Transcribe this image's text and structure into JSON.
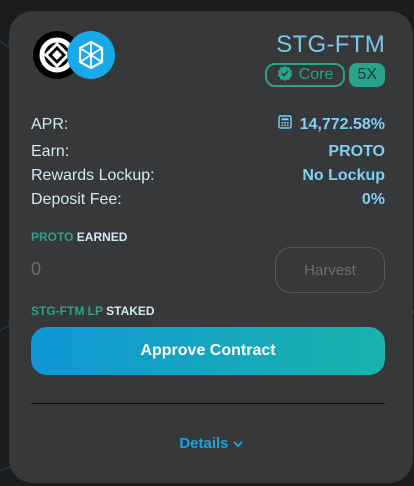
{
  "farm": {
    "pair": "STG-FTM",
    "badge_core": "Core",
    "multiplier": "5X"
  },
  "stats": [
    {
      "label": "APR:",
      "value": "14,772.58%",
      "icon": "calculator-icon"
    },
    {
      "label": "Earn:",
      "value": "PROTO"
    },
    {
      "label": "Rewards Lockup:",
      "value": "No Lockup"
    },
    {
      "label": "Deposit Fee:",
      "value": "0%"
    }
  ],
  "earned": {
    "token": "PROTO",
    "suffix": "EARNED",
    "amount": "0",
    "harvest_label": "Harvest"
  },
  "staked": {
    "token": "STG-FTM LP",
    "suffix": "STAKED",
    "approve_label": "Approve Contract"
  },
  "details_label": "Details",
  "colors": {
    "accent_blue": "#17a3e0",
    "accent_green": "#2aa38b",
    "card_bg": "#373839"
  }
}
